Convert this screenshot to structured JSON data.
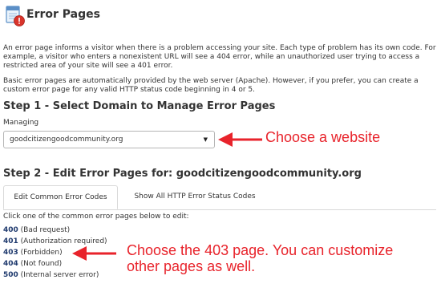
{
  "header": {
    "title": "Error Pages",
    "icon": "error-pages-icon"
  },
  "intro": {
    "p1": "An error page informs a visitor when there is a problem accessing your site. Each type of problem has its own code. For example, a visitor who enters a nonexistent URL will see a 404 error, while an unauthorized user trying to access a restricted area of your site will see a 401 error.",
    "p2": "Basic error pages are automatically provided by the web server (Apache). However, if you prefer, you can create a custom error page for any valid HTTP status code beginning in 4 or 5."
  },
  "step1": {
    "title": "Step 1 - Select Domain to Manage Error Pages",
    "managing_label": "Managing",
    "selected_domain": "goodcitizengoodcommunity.org"
  },
  "step2": {
    "title": "Step 2 - Edit Error Pages for: goodcitizengoodcommunity.org",
    "tabs": [
      {
        "label": "Edit Common Error Codes",
        "active": true
      },
      {
        "label": "Show All HTTP Error Status Codes",
        "active": false
      }
    ],
    "instructions": "Click one of the common error pages below to edit:",
    "codes": [
      {
        "code": "400",
        "label": "(Bad request)"
      },
      {
        "code": "401",
        "label": "(Authorization required)"
      },
      {
        "code": "403",
        "label": "(Forbidden)"
      },
      {
        "code": "404",
        "label": "(Not found)"
      },
      {
        "code": "500",
        "label": "(Internal server error)"
      }
    ]
  },
  "annotations": {
    "choose_website": "Choose a website",
    "choose_403_line1": "Choose the 403 page. You can customize",
    "choose_403_line2": "other pages as well."
  },
  "colors": {
    "accent_red": "#e8232b",
    "link_blue": "#1f3a6e"
  }
}
